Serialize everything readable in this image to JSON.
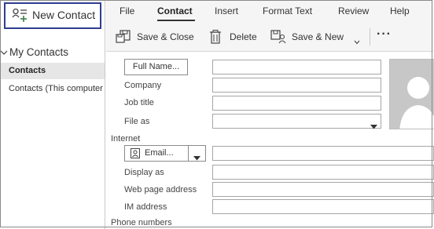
{
  "nav": {
    "new_contact_label": "New Contact",
    "folder_group": "My Contacts",
    "items": [
      {
        "label": "Contacts",
        "selected": true
      },
      {
        "label": "Contacts (This computer only)",
        "selected": false
      }
    ]
  },
  "menu": {
    "tabs": [
      "File",
      "Contact",
      "Insert",
      "Format Text",
      "Review",
      "Help"
    ],
    "active_tab": "Contact"
  },
  "ribbon": {
    "save_close": "Save & Close",
    "delete": "Delete",
    "save_new": "Save & New",
    "more": "···"
  },
  "form": {
    "full_name_button": "Full Name...",
    "company_label": "Company",
    "job_title_label": "Job title",
    "file_as_label": "File as",
    "internet_section": "Internet",
    "email_button": "Email...",
    "display_as_label": "Display as",
    "web_page_label": "Web page address",
    "im_address_label": "IM address",
    "phone_section": "Phone numbers",
    "values": {
      "full_name": "",
      "company": "",
      "job_title": "",
      "file_as": "",
      "email": "",
      "display_as": "",
      "web_page": "",
      "im_address": ""
    }
  },
  "colors": {
    "new_contact_border": "#2f3d8f",
    "new_contact_icon": "#3a7d44",
    "selected_item_bg": "#e6e6e6"
  },
  "icons": [
    "new-contact-icon",
    "chevron-down-icon",
    "save-close-icon",
    "trash-icon",
    "save-new-icon",
    "dropdown-arrow-icon",
    "contact-card-icon",
    "photo-placeholder-icon"
  ]
}
